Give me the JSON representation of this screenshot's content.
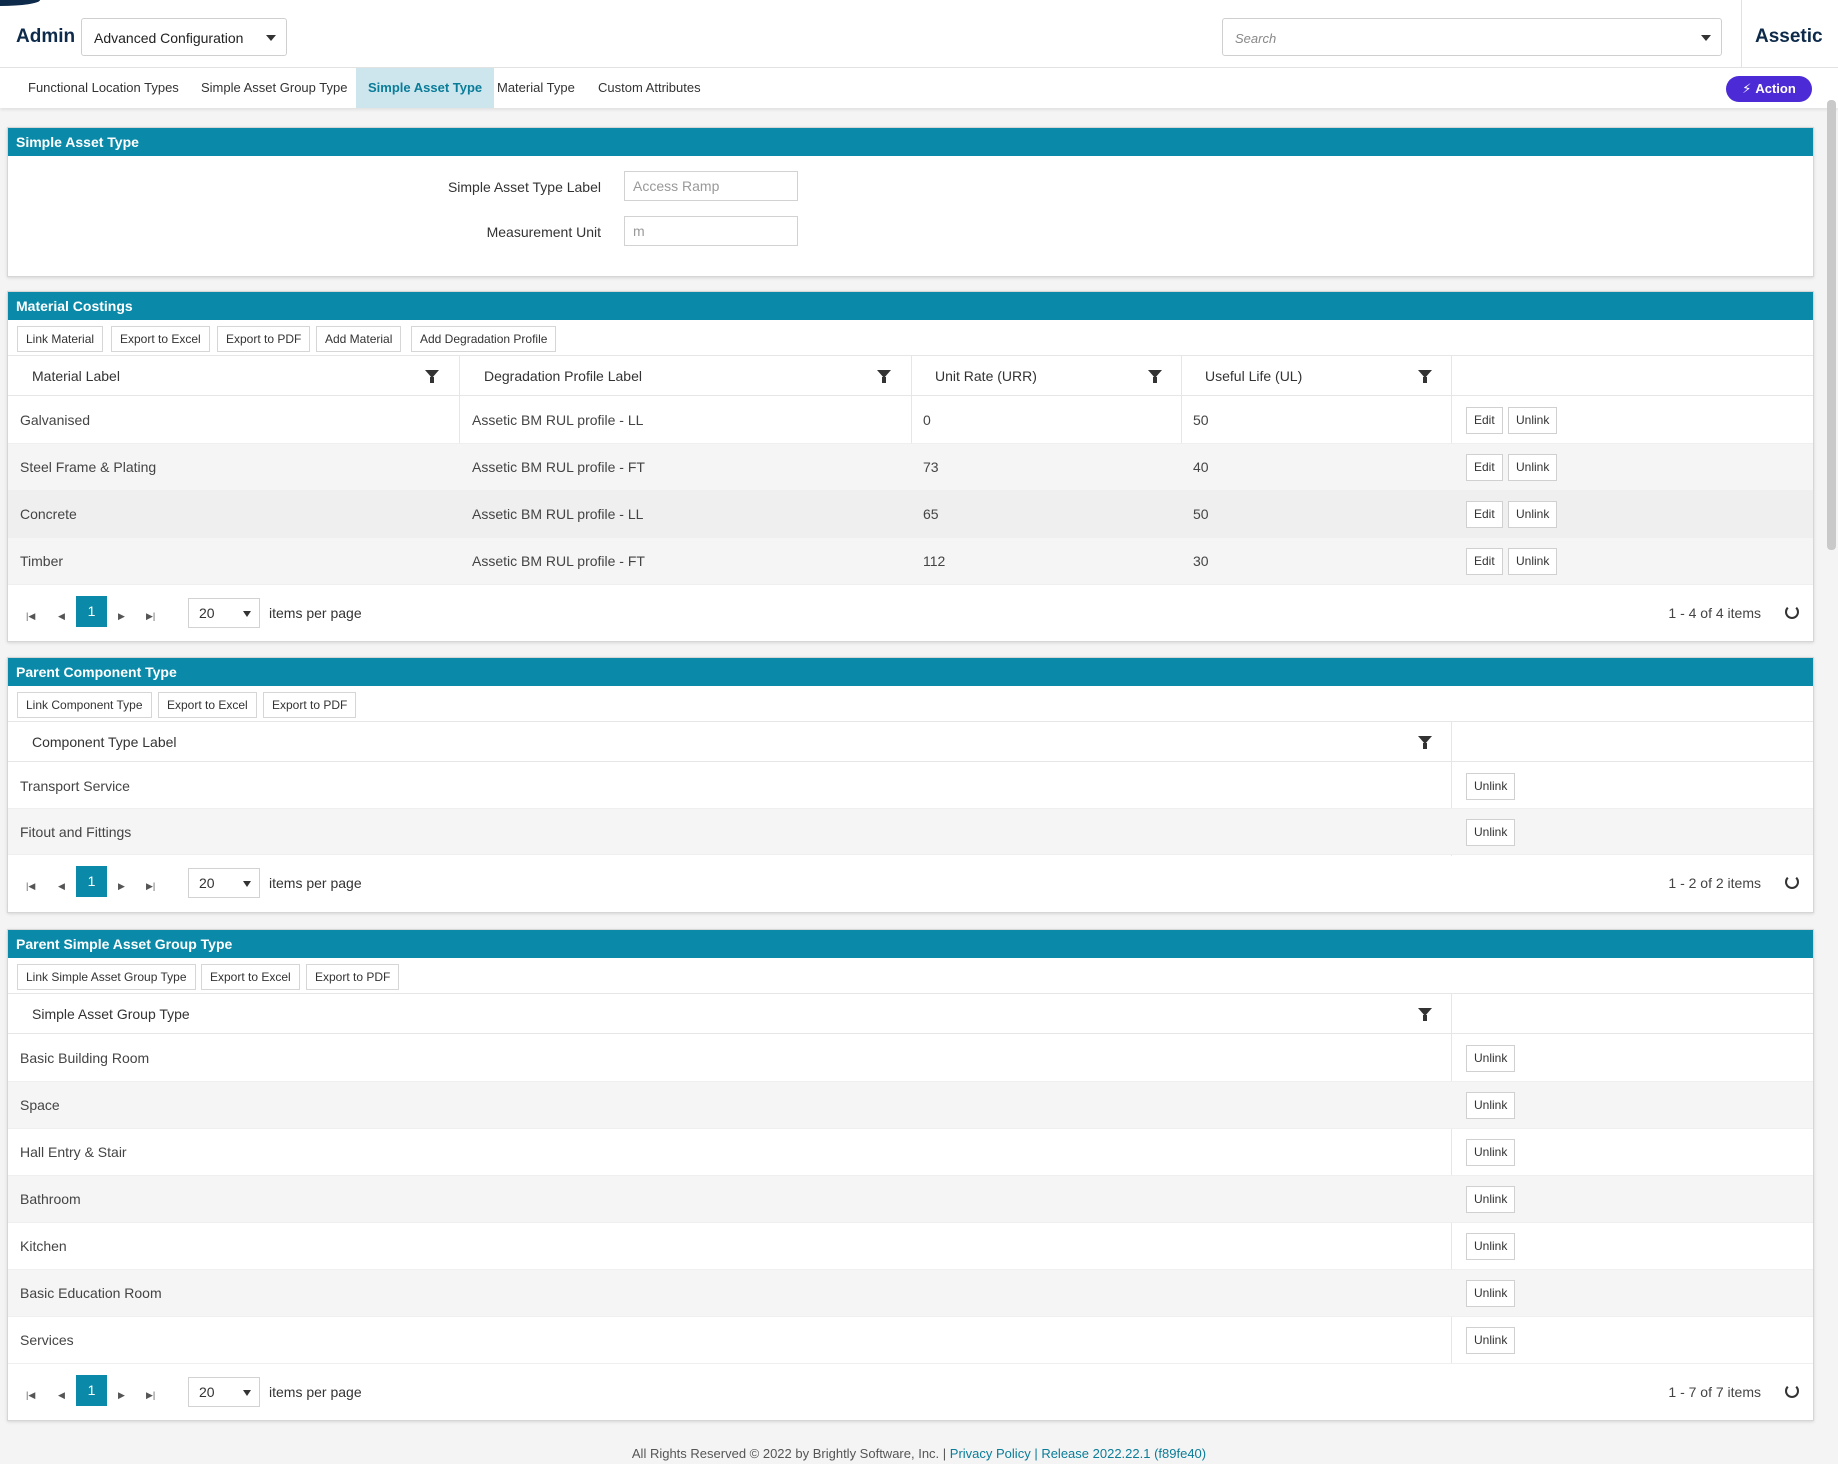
{
  "header": {
    "app_name": "Admin",
    "config_select": "Advanced Configuration",
    "search_placeholder": "Search",
    "brand": "Assetic"
  },
  "tabs": [
    {
      "label": "Functional Location Types"
    },
    {
      "label": "Simple Asset Group Type"
    },
    {
      "label": "Simple Asset Type"
    },
    {
      "label": "Material Type"
    },
    {
      "label": "Custom Attributes"
    }
  ],
  "action_label": "Action",
  "simple_asset_type": {
    "title": "Simple Asset Type",
    "label_field": {
      "label": "Simple Asset Type Label",
      "value": "Access Ramp"
    },
    "unit_field": {
      "label": "Measurement Unit",
      "value": "m"
    }
  },
  "material_costings": {
    "title": "Material Costings",
    "toolbar": [
      "Link Material",
      "Export to Excel",
      "Export to PDF",
      "Add Material",
      "Add Degradation Profile"
    ],
    "columns": [
      "Material Label",
      "Degradation Profile Label",
      "Unit Rate (URR)",
      "Useful Life (UL)"
    ],
    "rows": [
      {
        "material": "Galvanised",
        "profile": "Assetic BM RUL profile - LL",
        "rate": "0",
        "life": "50"
      },
      {
        "material": "Steel Frame & Plating",
        "profile": "Assetic BM RUL profile - FT",
        "rate": "73",
        "life": "40"
      },
      {
        "material": "Concrete",
        "profile": "Assetic BM RUL profile - LL",
        "rate": "65",
        "life": "50"
      },
      {
        "material": "Timber",
        "profile": "Assetic BM RUL profile - FT",
        "rate": "112",
        "life": "30"
      }
    ],
    "edit_label": "Edit",
    "unlink_label": "Unlink",
    "pager": {
      "page": "1",
      "size": "20",
      "per_page": "items per page",
      "info": "1 - 4 of 4 items"
    }
  },
  "parent_component": {
    "title": "Parent Component Type",
    "toolbar": [
      "Link Component Type",
      "Export to Excel",
      "Export to PDF"
    ],
    "column": "Component Type Label",
    "rows": [
      "Transport Service",
      "Fitout and Fittings"
    ],
    "unlink_label": "Unlink",
    "pager": {
      "page": "1",
      "size": "20",
      "per_page": "items per page",
      "info": "1 - 2 of 2 items"
    }
  },
  "parent_group": {
    "title": "Parent Simple Asset Group Type",
    "toolbar": [
      "Link Simple Asset Group Type",
      "Export to Excel",
      "Export to PDF"
    ],
    "column": "Simple Asset Group Type",
    "rows": [
      "Basic Building Room",
      "Space",
      "Hall Entry & Stair",
      "Bathroom",
      "Kitchen",
      "Basic Education Room",
      "Services"
    ],
    "unlink_label": "Unlink",
    "pager": {
      "page": "1",
      "size": "20",
      "per_page": "items per page",
      "info": "1 - 7 of 7 items"
    }
  },
  "footer": {
    "text": "All Rights Reserved © 2022 by Brightly Software, Inc. |",
    "privacy": "Privacy Policy",
    "release": "| Release 2022.22.1 (f89fe40)"
  }
}
